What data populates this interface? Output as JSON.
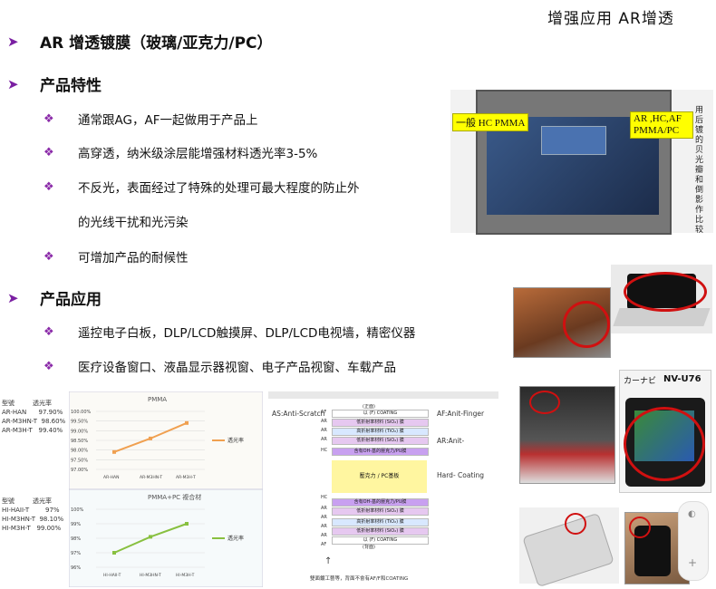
{
  "corner_title": "增强应用 AR增透",
  "heading_main": "AR 增透镀膜（玻璃/亚克力/PC）",
  "section_features": {
    "title": "产品特性",
    "bullets": [
      "通常跟AG，AF一起做用于产品上",
      "高穿透，纳米级涂层能增强材料透光率3-5%",
      "不反光，表面经过了特殊的处理可最大程度的防止外"
    ],
    "continuation": "的光线干扰和光污染",
    "bullet4": "可增加产品的耐候性"
  },
  "section_apps": {
    "title": "产品应用",
    "bullets": [
      "遥控电子白板，DLP/LCD触摸屏、DLP/LCD电视墙，精密仪器",
      "医疗设备窗口、液晶显示器视窗、电子产品视窗、车载产品"
    ]
  },
  "monitor_photo": {
    "label_left": "一般 HC PMMA",
    "label_right": "AR ,HC,AF PMMA/PC",
    "side_text": "用后镀的贝光瓣和倒影作比较"
  },
  "nav_photo": {
    "label_left": "カーナビ",
    "label_right": "NV-U76"
  },
  "charts": {
    "chart_data": [
      {
        "type": "line",
        "title": "PMMA",
        "categories": [
          "AR-HAN",
          "AR-M3HN-T",
          "AR-M3H-T"
        ],
        "values": [
          97.9,
          98.6,
          99.4
        ],
        "ylim": [
          97.0,
          100.0
        ],
        "yticks": [
          "100.00%",
          "99.50%",
          "99.00%",
          "98.50%",
          "98.00%",
          "97.50%",
          "97.00%"
        ],
        "legend": "透光率",
        "color": "#f0a050"
      },
      {
        "type": "line",
        "title": "PMMA+PC 複合材",
        "categories": [
          "HI-HAII-T",
          "HI-M3HN-T",
          "HI-M3H-T"
        ],
        "values": [
          97.0,
          98.1,
          99.0
        ],
        "ylim": [
          96,
          100
        ],
        "yticks": [
          "100%",
          "99%",
          "98%",
          "97%",
          "96%"
        ],
        "legend": "透光率",
        "color": "#88c040"
      }
    ],
    "table1": {
      "header": [
        "型號",
        "透光率"
      ],
      "rows": [
        [
          "AR-HAN",
          "97.90%"
        ],
        [
          "AR-M3HN-T",
          "98.60%"
        ],
        [
          "AR-M3H-T",
          "99.40%"
        ]
      ]
    },
    "table2": {
      "header": [
        "型號",
        "透光率"
      ],
      "rows": [
        [
          "HI-HAII-T",
          "97%"
        ],
        [
          "HI-M3HN-T",
          "98.10%"
        ],
        [
          "HI-M3H-T",
          "99.00%"
        ]
      ]
    }
  },
  "stack_diagram": {
    "left_top": "AS:Anti-Scratch",
    "right_labels": [
      "AF:Anit-Finger",
      "AR:Anit-",
      "Hard- Coating"
    ],
    "top_label": "(正面)",
    "center_label": "壓克力 / PC基板",
    "bottom_label": "(背面)",
    "caption": "雙面鍍工藝等，背面不會有AF/F和COATING",
    "left_marks": [
      "AF",
      "AR",
      "AR",
      "AR",
      "HC",
      "HC",
      "AR",
      "AR",
      "AR",
      "AR",
      "AF"
    ],
    "layer_text": [
      "以 (F) COATING",
      "低折射率材料 (SiO₂) 膜",
      "高折射率材料 (TiO₂) 膜",
      "低折射率材料 (SiO₂) 膜",
      "含有OH-基的壓克力/PU膜",
      "含有OH-基的壓克力/PU膜",
      "低折射率材料 (SiO₂) 膜",
      "高折射率材料 (TiO₂) 膜",
      "低折射率材料 (SiO₂) 膜",
      "以 (F) COATING"
    ]
  }
}
